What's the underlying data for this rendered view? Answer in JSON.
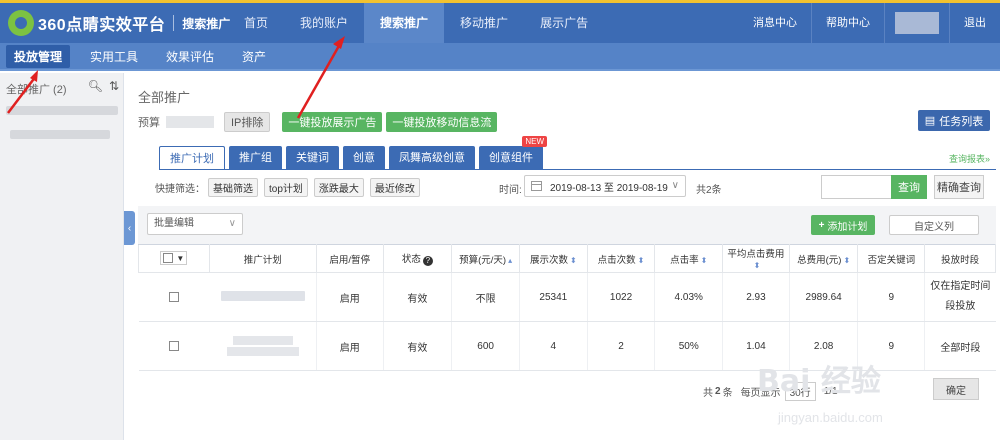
{
  "topbar": {
    "logo": "360点睛实效平台",
    "product": "搜索推广",
    "nav": [
      "首页",
      "我的账户",
      "搜索推广",
      "移动推广",
      "展示广告"
    ],
    "right_nav": [
      "消息中心",
      "帮助中心",
      "退出"
    ]
  },
  "subbar": {
    "items": [
      "投放管理",
      "实用工具",
      "效果评估",
      "资产"
    ]
  },
  "sidebar": {
    "title": "全部推广 (2)"
  },
  "main": {
    "breadcrumb": "全部推广",
    "pre_label": "预算",
    "ip_exclude": "IP排除",
    "one_click_display": "一键投放展示广告",
    "one_click_mobile": "一键投放移动信息流",
    "task_list": "任务列表",
    "tabs": [
      "推广计划",
      "推广组",
      "关键词",
      "创意",
      "凤舞高级创意",
      "创意组件"
    ],
    "tab_badge": "NEW",
    "query_report": "查询报表»",
    "quick_filter_label": "快捷筛选：",
    "quick_filters": [
      "基础筛选",
      "top计划",
      "涨跌最大",
      "最近修改"
    ],
    "time_label": "时间:",
    "date_range": "2019-08-13 至 2019-08-19",
    "total_items": "共2条",
    "search_button": "查询",
    "exact_button": "精确查询",
    "batch_edit": "批量编辑",
    "add_plan": "添加计划",
    "custom_columns": "自定义列"
  },
  "table": {
    "headers": [
      "推广计划",
      "启用/暂停",
      "状态",
      "预算(元/天)",
      "展示次数",
      "点击次数",
      "点击率",
      "平均点击费用",
      "总费用(元)",
      "否定关键词",
      "投放时段"
    ],
    "rows": [
      {
        "toggle": "启用",
        "status": "有效",
        "budget": "不限",
        "impressions": "25341",
        "clicks": "1022",
        "ctr": "4.03%",
        "avg_cpc": "2.93",
        "total_cost": "2989.64",
        "negative_keywords": "9",
        "schedule": "仅在指定时间段投放"
      },
      {
        "toggle": "启用",
        "status": "有效",
        "budget": "600",
        "impressions": "4",
        "clicks": "2",
        "ctr": "50%",
        "avg_cpc": "1.04",
        "total_cost": "2.08",
        "negative_keywords": "9",
        "schedule": "全部时段"
      }
    ]
  },
  "pager": {
    "total_prefix": "共",
    "total_count": "2",
    "total_suffix": "条",
    "per_page_label": "每页显示",
    "per_page": "30行",
    "page": "1/1",
    "confirm": "确定"
  },
  "watermark": {
    "text": "Bai 经验",
    "sub": "jingyan.baidu.com"
  },
  "colors": {
    "header": "#3c6bb4",
    "subbar": "#5583c7",
    "green": "#58b562",
    "annotation": "#e02020"
  }
}
